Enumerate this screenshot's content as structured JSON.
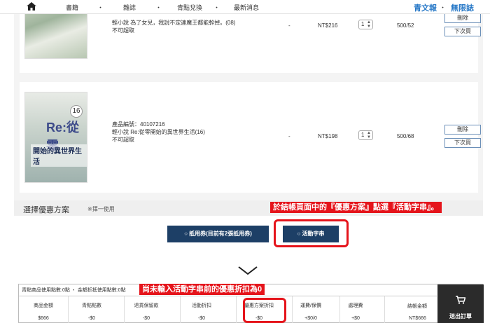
{
  "nav": {
    "items": [
      "書籍",
      "雜誌",
      "青點兌換",
      "最新消息"
    ],
    "brand1": "青文報",
    "brand2": "無限誌"
  },
  "products": [
    {
      "title": "輕小說 為了女兒，我說不定連魔王都能幹掉。(08)",
      "status": "不可超取",
      "dash": "-",
      "price": "NT$216",
      "qty": "1",
      "points": "500/52",
      "delete_label": "刪除",
      "later_label": "下次買"
    },
    {
      "code": "產品編號：40107216",
      "title": "輕小說 Re:從零開始的異世界生活(16)",
      "status": "不可超取",
      "dash": "-",
      "price": "NT$198",
      "qty": "1",
      "points": "500/68",
      "delete_label": "刪除",
      "later_label": "下次買"
    }
  ],
  "cover2": {
    "title": "Re:從零",
    "subtitle": "開始的異世界生活",
    "volume": "16"
  },
  "coupon": {
    "title": "選擇優惠方案",
    "hint": "※擇一使用",
    "coupon_button": "抵用券(目前有2張抵用券)",
    "activity_button": "活動字串",
    "annotation": "於結帳頁面中的『優惠方案』點選『活動字串』。"
  },
  "summary": {
    "head": "青點商品使用點數:0點 ・ 金額折抵使用點數:0點",
    "annotation": "尚未輸入活動字串前的優惠折扣為0",
    "columns": [
      "商品金額",
      "青點點數",
      "退貨保留款",
      "活動折扣",
      "優惠方案折扣",
      "運費/保價",
      "處理費"
    ],
    "values": [
      "$666",
      "-$0",
      "-$0",
      "-$0",
      "-$0",
      "+$0/0",
      "+$0"
    ],
    "total_label": "結帳金額",
    "total_value": "NT$666",
    "checkout_label": "送出訂單"
  }
}
